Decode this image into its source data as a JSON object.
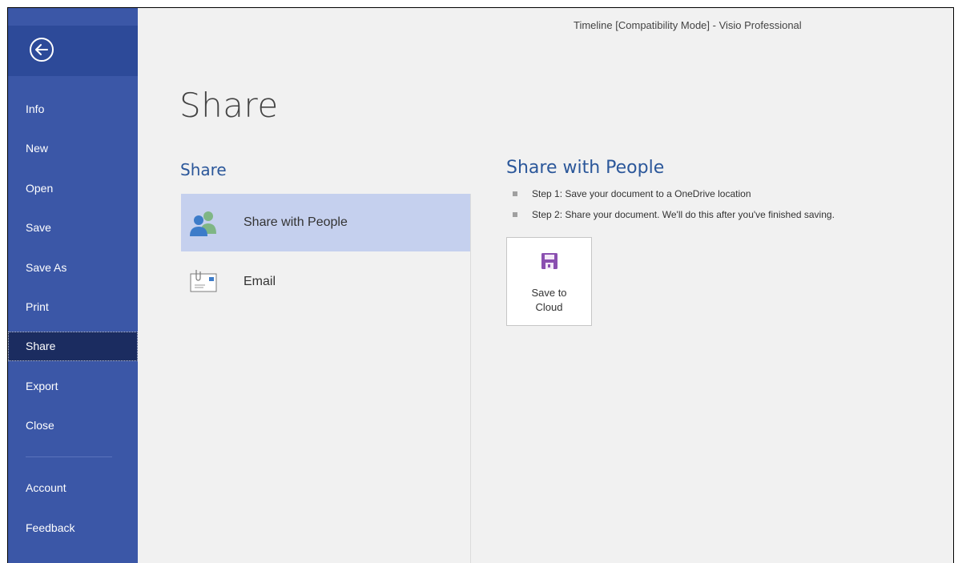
{
  "window": {
    "title": "Timeline  [Compatibility Mode]  -  Visio Professional"
  },
  "sidebar": {
    "items": [
      {
        "label": "Info"
      },
      {
        "label": "New"
      },
      {
        "label": "Open"
      },
      {
        "label": "Save"
      },
      {
        "label": "Save As"
      },
      {
        "label": "Print"
      },
      {
        "label": "Share",
        "selected": true
      },
      {
        "label": "Export"
      },
      {
        "label": "Close"
      },
      {
        "label": "Account"
      },
      {
        "label": "Feedback"
      }
    ],
    "colors": {
      "background": "#3b57a7",
      "selected": "#1b2c60"
    }
  },
  "main": {
    "title": "Share",
    "share_section": {
      "heading": "Share",
      "options": [
        {
          "label": "Share with People",
          "icon": "people-icon",
          "active": true
        },
        {
          "label": "Email",
          "icon": "email-icon",
          "active": false
        }
      ]
    },
    "detail": {
      "heading": "Share with People",
      "steps": [
        "Step 1: Save your document to a OneDrive location",
        "Step 2: Share your document. We'll do this after you've finished saving."
      ],
      "save_button": {
        "label": "Save to\nCloud",
        "icon": "floppy-disk-icon",
        "icon_color": "#8a4fb0"
      }
    }
  }
}
